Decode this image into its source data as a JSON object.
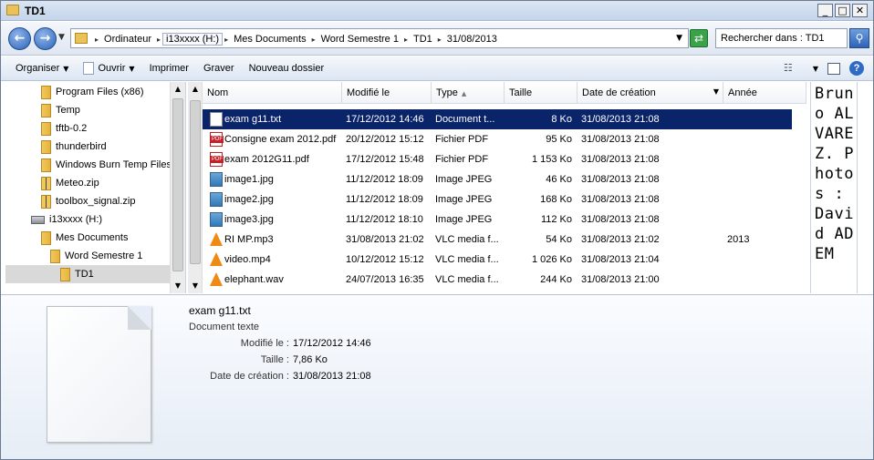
{
  "window": {
    "title": "TD1"
  },
  "address": {
    "crumbs": [
      "Ordinateur",
      "i13xxxx (H:)",
      "Mes Documents",
      "Word Semestre 1",
      "TD1",
      "31/08/2013"
    ]
  },
  "search": {
    "placeholder": "Rechercher dans : TD1"
  },
  "toolbar": {
    "organize": "Organiser",
    "open": "Ouvrir",
    "print": "Imprimer",
    "burn": "Graver",
    "new_folder": "Nouveau dossier"
  },
  "nav": {
    "items": [
      {
        "label": "Program Files (x86)",
        "icon": "folder-icon"
      },
      {
        "label": "Temp",
        "icon": "folder-icon"
      },
      {
        "label": "tftb-0.2",
        "icon": "folder-icon"
      },
      {
        "label": "thunderbird",
        "icon": "folder-icon"
      },
      {
        "label": "Windows Burn Temp Files",
        "icon": "folder-icon"
      },
      {
        "label": "Meteo.zip",
        "icon": "zip-folder-icon"
      },
      {
        "label": "toolbox_signal.zip",
        "icon": "zip-folder-icon"
      },
      {
        "label": "i13xxxx (H:)",
        "icon": "drive-icon"
      },
      {
        "label": "Mes Documents",
        "icon": "folder-icon"
      },
      {
        "label": "Word Semestre 1",
        "icon": "folder-icon"
      },
      {
        "label": "TD1",
        "icon": "folder-icon"
      }
    ]
  },
  "columns": {
    "name": "Nom",
    "modified": "Modifié le",
    "type": "Type",
    "size": "Taille",
    "created": "Date de création",
    "year": "Année"
  },
  "files": [
    {
      "name": "exam g11.txt",
      "modified": "17/12/2012 14:46",
      "type": "Document t...",
      "size": "8 Ko",
      "created": "31/08/2013 21:08",
      "year": "",
      "icon": "text-file-icon"
    },
    {
      "name": "Consigne exam 2012.pdf",
      "modified": "20/12/2012 15:12",
      "type": "Fichier PDF",
      "size": "95 Ko",
      "created": "31/08/2013 21:08",
      "year": "",
      "icon": "pdf-file-icon"
    },
    {
      "name": "exam 2012G11.pdf",
      "modified": "17/12/2012 15:48",
      "type": "Fichier PDF",
      "size": "1 153 Ko",
      "created": "31/08/2013 21:08",
      "year": "",
      "icon": "pdf-file-icon"
    },
    {
      "name": "image1.jpg",
      "modified": "11/12/2012 18:09",
      "type": "Image JPEG",
      "size": "46 Ko",
      "created": "31/08/2013 21:08",
      "year": "",
      "icon": "image-file-icon"
    },
    {
      "name": "image2.jpg",
      "modified": "11/12/2012 18:09",
      "type": "Image JPEG",
      "size": "168 Ko",
      "created": "31/08/2013 21:08",
      "year": "",
      "icon": "image-file-icon"
    },
    {
      "name": "image3.jpg",
      "modified": "11/12/2012 18:10",
      "type": "Image JPEG",
      "size": "112 Ko",
      "created": "31/08/2013 21:08",
      "year": "",
      "icon": "image-file-icon"
    },
    {
      "name": "RI MP.mp3",
      "modified": "31/08/2013 21:02",
      "type": "VLC media f...",
      "size": "54 Ko",
      "created": "31/08/2013 21:02",
      "year": "2013",
      "icon": "vlc-media-icon"
    },
    {
      "name": "video.mp4",
      "modified": "10/12/2012 15:12",
      "type": "VLC media f...",
      "size": "1 026 Ko",
      "created": "31/08/2013 21:04",
      "year": "",
      "icon": "vlc-media-icon"
    },
    {
      "name": "elephant.wav",
      "modified": "24/07/2013 16:35",
      "type": "VLC media f...",
      "size": "244 Ko",
      "created": "31/08/2013 21:00",
      "year": "",
      "icon": "vlc-media-icon"
    }
  ],
  "side_text": "Bruno ALVAREZ. Photos : David ADEM",
  "details": {
    "name": "exam g11.txt",
    "type": "Document texte",
    "modified_label": "Modifié le :",
    "modified": "17/12/2012 14:46",
    "size_label": "Taille :",
    "size": "7,86 Ko",
    "created_label": "Date de création :",
    "created": "31/08/2013 21:08"
  }
}
